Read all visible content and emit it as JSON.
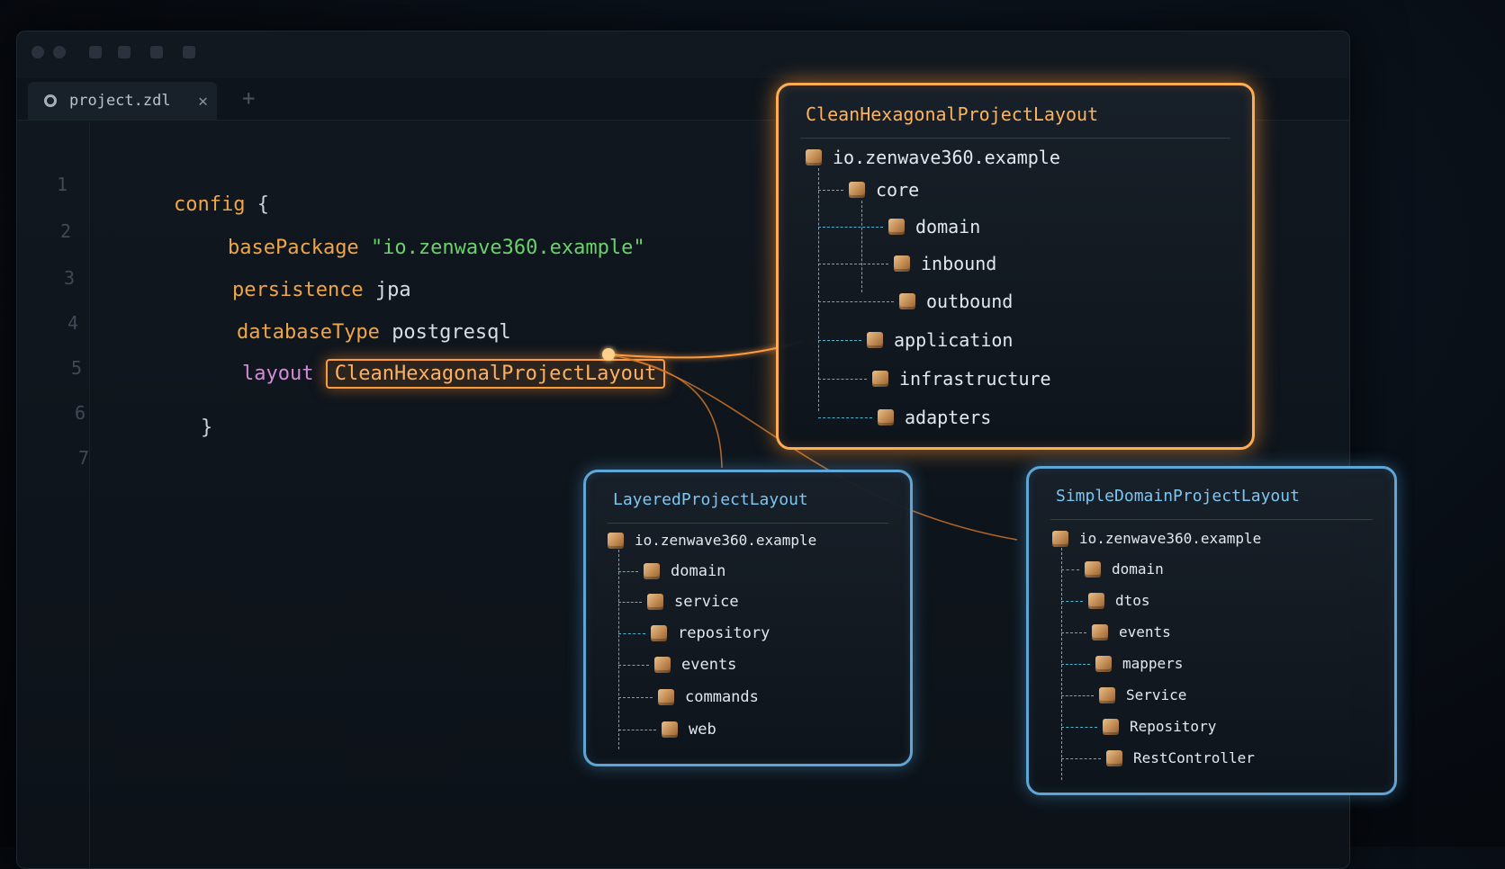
{
  "tab": {
    "filename": "project.zdl",
    "close": "✕",
    "new": "+"
  },
  "line_numbers": [
    "1",
    "2",
    "3",
    "4",
    "5",
    "6",
    "7"
  ],
  "code": {
    "config_kw": "config",
    "open_brace": "{",
    "base_package_key": "basePackage",
    "base_package_value": "\"io.zenwave360.example\"",
    "persistence_key": "persistence",
    "persistence_value": "jpa",
    "database_key": "databaseType",
    "database_value": "postgresql",
    "layout_key": "layout",
    "layout_value": "CleanHexagonalProjectLayout",
    "close_brace": "}"
  },
  "cards": {
    "hexagonal": {
      "title": "CleanHexagonalProjectLayout",
      "root": "io.zenwave360.example",
      "core": "core",
      "core_children": [
        "domain",
        "inbound",
        "outbound"
      ],
      "siblings": [
        "application",
        "infrastructure",
        "adapters"
      ]
    },
    "layered": {
      "title": "LayeredProjectLayout",
      "root": "io.zenwave360.example",
      "children": [
        "domain",
        "service",
        "repository",
        "events",
        "commands",
        "web"
      ]
    },
    "simple": {
      "title": "SimpleDomainProjectLayout",
      "root": "io.zenwave360.example",
      "children": [
        "domain",
        "dtos",
        "events",
        "mappers",
        "Service",
        "Repository",
        "RestController"
      ]
    }
  },
  "colors": {
    "accent_orange": "#ffad55",
    "accent_blue": "#5fa6d6",
    "tree_line": "#4fb6d0"
  },
  "icons": {
    "package": "package-box-icon",
    "settings": "gear-icon"
  }
}
